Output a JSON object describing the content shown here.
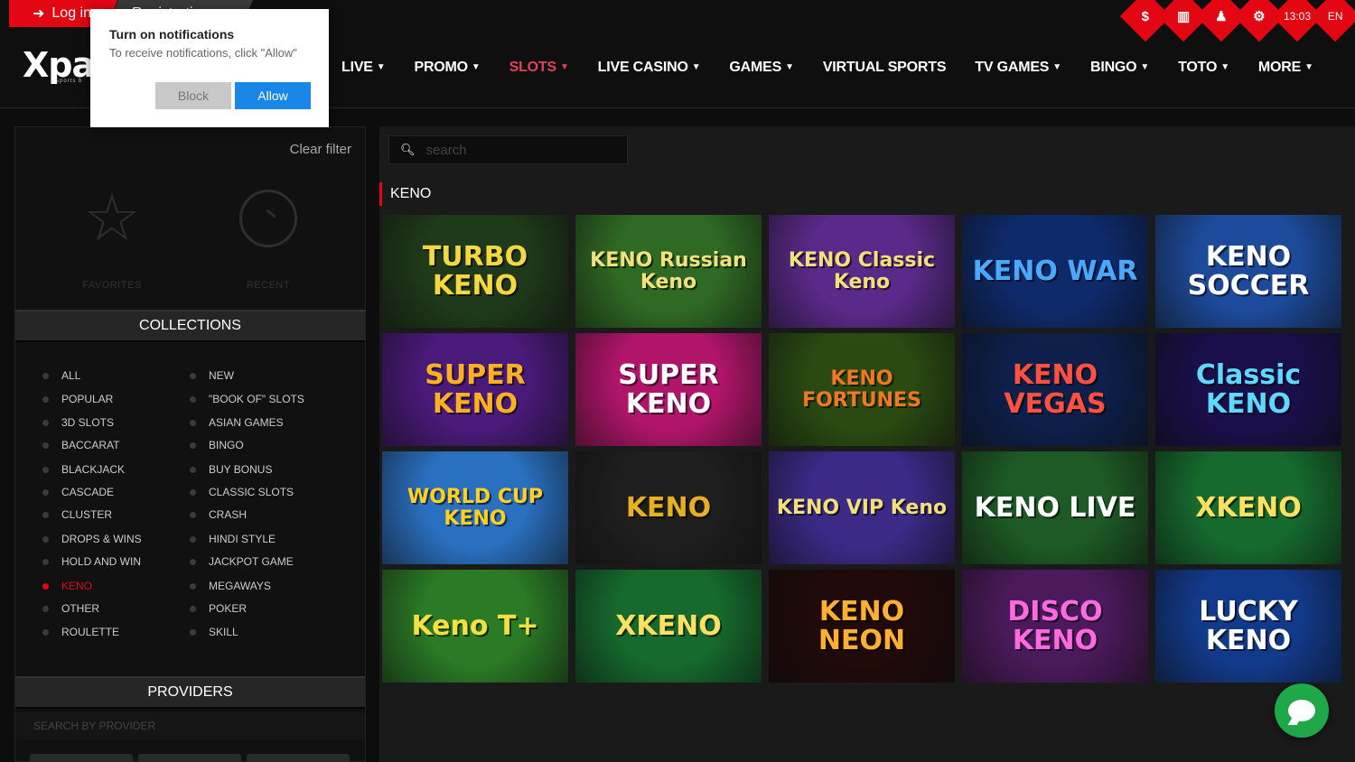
{
  "header": {
    "login_label": "Log in",
    "register_label": "Registration",
    "logo_text": "Xpa",
    "logo_subtext": "sports b",
    "time": "13:03",
    "lang": "EN",
    "nav": [
      {
        "label": "LIVE",
        "has_dropdown": true,
        "active": false
      },
      {
        "label": "PROMO",
        "has_dropdown": true,
        "active": false
      },
      {
        "label": "SLOTS",
        "has_dropdown": true,
        "active": true
      },
      {
        "label": "LIVE CASINO",
        "has_dropdown": true,
        "active": false
      },
      {
        "label": "GAMES",
        "has_dropdown": true,
        "active": false
      },
      {
        "label": "VIRTUAL SPORTS",
        "has_dropdown": false,
        "active": false
      },
      {
        "label": "TV GAMES",
        "has_dropdown": true,
        "active": false
      },
      {
        "label": "BINGO",
        "has_dropdown": true,
        "active": false
      },
      {
        "label": "TOTO",
        "has_dropdown": true,
        "active": false
      },
      {
        "label": "MORE",
        "has_dropdown": true,
        "active": false
      }
    ],
    "corner_icons": [
      "dollar-icon",
      "stats-icon",
      "bell-icon",
      "gear-icon",
      "clock-icon",
      "flag-icon"
    ],
    "accent_color": "#e30613"
  },
  "notification": {
    "title": "Turn on notifications",
    "text": "To receive notifications, click \"Allow\"",
    "block_label": "Block",
    "allow_label": "Allow"
  },
  "sidebar": {
    "clear_filter": "Clear filter",
    "favorites_label": "FAVORITES",
    "recent_label": "RECENT",
    "collections_title": "COLLECTIONS",
    "collections_left": [
      "ALL",
      "POPULAR",
      "3D SLOTS",
      "BACCARAT",
      "BLACKJACK",
      "CASCADE",
      "CLUSTER",
      "DROPS & WINS",
      "HOLD AND WIN",
      "KENO",
      "OTHER",
      "ROULETTE"
    ],
    "collections_right": [
      "NEW",
      "\"BOOK OF\" SLOTS",
      "ASIAN GAMES",
      "BINGO",
      "BUY BONUS",
      "CLASSIC SLOTS",
      "CRASH",
      "HINDI STYLE",
      "JACKPOT GAME",
      "MEGAWAYS",
      "POKER",
      "SKILL"
    ],
    "active_collection": "KENO",
    "providers_title": "PROVIDERS",
    "provider_search_placeholder": "SEARCH BY PROVIDER"
  },
  "main": {
    "search_placeholder": "search",
    "category_title": "KENO",
    "games": [
      {
        "title": "TURBO KENO",
        "bg": "#1f3a1a",
        "fg": "#f5d742"
      },
      {
        "title": "KENO Russian Keno",
        "bg": "#2f6a24",
        "fg": "#f2e07a"
      },
      {
        "title": "KENO Classic Keno",
        "bg": "#5a2a8a",
        "fg": "#f2e07a"
      },
      {
        "title": "KENO WAR",
        "bg": "#0e2a6a",
        "fg": "#4aa8ff"
      },
      {
        "title": "KENO SOCCER",
        "bg": "#1d4a9a",
        "fg": "#ffffff"
      },
      {
        "title": "SUPER KENO",
        "bg": "#4a1a7a",
        "fg": "#ffb020"
      },
      {
        "title": "SUPER KENO",
        "bg": "#b0156a",
        "fg": "#ffffff"
      },
      {
        "title": "KENO FORTUNES",
        "bg": "#2a4a12",
        "fg": "#f07820"
      },
      {
        "title": "KENO VEGAS",
        "bg": "#0d1f4a",
        "fg": "#ff5040"
      },
      {
        "title": "Classic KENO",
        "bg": "#1a0f4a",
        "fg": "#5fd8ff"
      },
      {
        "title": "WORLD CUP KENO",
        "bg": "#2a70c0",
        "fg": "#ffd020"
      },
      {
        "title": "KENO",
        "bg": "#1e1e1e",
        "fg": "#e8b020"
      },
      {
        "title": "KENO VIP Keno",
        "bg": "#3b2a86",
        "fg": "#f2e07a"
      },
      {
        "title": "KENO LIVE",
        "bg": "#1d5a25",
        "fg": "#ffffff"
      },
      {
        "title": "XKENO",
        "bg": "#166a2e",
        "fg": "#ffe060"
      },
      {
        "title": "Keno T+",
        "bg": "#2a7a26",
        "fg": "#f5e040"
      },
      {
        "title": "XKENO",
        "bg": "#166a2e",
        "fg": "#ffe060"
      },
      {
        "title": "KENO NEON",
        "bg": "#200a0a",
        "fg": "#ffb030"
      },
      {
        "title": "DISCO KENO",
        "bg": "#4a1a5a",
        "fg": "#ff6ae0"
      },
      {
        "title": "LUCKY KENO",
        "bg": "#123a8a",
        "fg": "#ffffff"
      }
    ]
  }
}
